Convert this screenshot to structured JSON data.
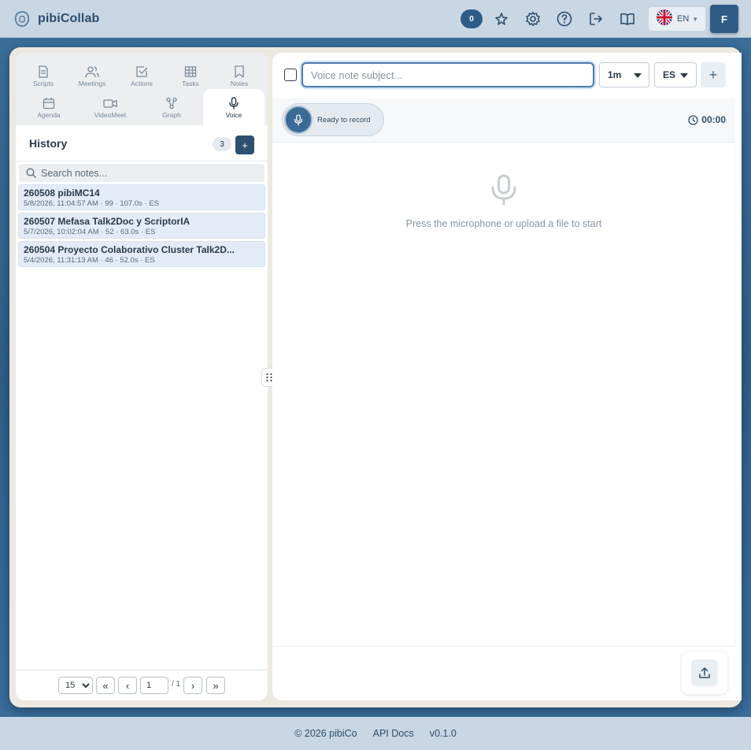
{
  "header": {
    "app_name": "pibiCollab",
    "notification_count": "0",
    "language": "EN",
    "user_initial": "F"
  },
  "tabs": [
    {
      "label": "Scripts",
      "icon": "document-icon"
    },
    {
      "label": "Meetings",
      "icon": "users-icon"
    },
    {
      "label": "Actions",
      "icon": "check-square-icon"
    },
    {
      "label": "Tasks",
      "icon": "grid-icon"
    },
    {
      "label": "Notes",
      "icon": "bookmark-icon"
    },
    {
      "label": "Agenda",
      "icon": "calendar-icon"
    },
    {
      "label": "VideoMeet",
      "icon": "video-icon"
    },
    {
      "label": "Graph",
      "icon": "graph-icon"
    },
    {
      "label": "Voice",
      "icon": "microphone-icon"
    }
  ],
  "history": {
    "title": "History",
    "count": "3",
    "add_label": "+",
    "search_placeholder": "Search notes...",
    "items": [
      {
        "title": "260508 pibiMC14",
        "meta": "5/8/2026, 11:04:57 AM · 99 · 107.0s · ES"
      },
      {
        "title": "260507 Mefasa Talk2Doc y ScriptorIA",
        "meta": "5/7/2026, 10:02:04 AM · 52 · 63.0s · ES"
      },
      {
        "title": "260504 Proyecto Colaborativo Cluster Talk2D...",
        "meta": "5/4/2026, 11:31:13 AM · 46 · 52.0s · ES"
      }
    ]
  },
  "pager": {
    "page_size": "15",
    "first": "«",
    "prev": "‹",
    "page": "1",
    "total": "/ 1",
    "next": "›",
    "last": "»"
  },
  "voice": {
    "subject_placeholder": "Voice note subject...",
    "duration": "1m",
    "language": "ES",
    "add_label": "+",
    "status": "Ready to record",
    "timer": "00:00",
    "empty_message": "Press the microphone or upload a file to start"
  },
  "footer": {
    "copyright": "© 2026 pibiCo",
    "api_docs": "API Docs",
    "version": "v0.1.0"
  },
  "colors": {
    "brand": "#2f4d6b",
    "accent": "#2e5c86",
    "header_bg": "#c9d6e3"
  }
}
